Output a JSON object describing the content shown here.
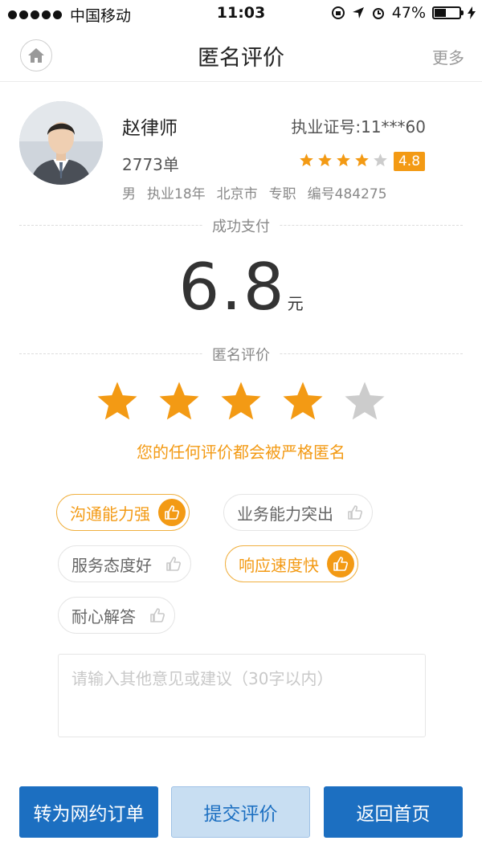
{
  "status_bar": {
    "carrier": "中国移动",
    "time": "11:03",
    "battery": "47%",
    "battery_level": 0.47
  },
  "nav": {
    "title": "匿名评价",
    "more": "更多"
  },
  "lawyer": {
    "name": "赵律师",
    "license": "执业证号:11***60",
    "orders": "2773单",
    "rating": "4.8",
    "rating_stars": 4,
    "meta": [
      "男",
      "执业18年",
      "北京市",
      "专职",
      "编号484275"
    ]
  },
  "payment": {
    "label": "成功支付",
    "amount": "6.8",
    "unit": "元"
  },
  "review": {
    "label": "匿名评价",
    "selected_stars": 4,
    "total_stars": 5,
    "note": "您的任何评价都会被严格匿名",
    "tags": [
      {
        "label": "沟通能力强",
        "selected": true
      },
      {
        "label": "业务能力突出",
        "selected": false
      },
      {
        "label": "服务态度好",
        "selected": false
      },
      {
        "label": "响应速度快",
        "selected": true
      },
      {
        "label": "耐心解答",
        "selected": false
      }
    ],
    "input_placeholder": "请输入其他意见或建议（30字以内）"
  },
  "buttons": {
    "convert": "转为网约订单",
    "submit": "提交评价",
    "home": "返回首页"
  },
  "colors": {
    "accent": "#f39a14",
    "primary": "#1c6fc1",
    "star_off": "#cccccc"
  }
}
